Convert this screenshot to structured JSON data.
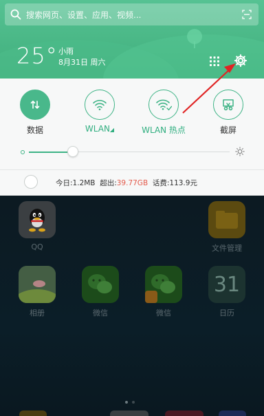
{
  "search": {
    "placeholder": "搜索网页、设置、应用、视频..."
  },
  "weather": {
    "temperature": "25°",
    "condition": "小雨",
    "date": "8月31日 周六"
  },
  "quick_settings": {
    "tiles": [
      {
        "label": "数据",
        "active": true
      },
      {
        "label": "WLAN",
        "active": false
      },
      {
        "label": "WLAN 热点",
        "active": false
      },
      {
        "label": "截屏",
        "active": false
      }
    ],
    "brightness_fraction": 0.22
  },
  "usage": {
    "today_label": "今日:",
    "today_value": "1.2MB",
    "over_label": "超出:",
    "over_value": "39.77GB",
    "bill_label": "话费:",
    "bill_value": "113.9元"
  },
  "home_apps": [
    {
      "label": "QQ"
    },
    {
      "label": "文件管理"
    },
    {
      "label": "相册"
    },
    {
      "label": "微信"
    },
    {
      "label": "微信"
    },
    {
      "calendar_day": "31",
      "label": "日历"
    }
  ],
  "colors": {
    "accent": "#3db385",
    "header": "#4bb886",
    "arrow": "#e02424",
    "warn": "#e35b4c"
  }
}
